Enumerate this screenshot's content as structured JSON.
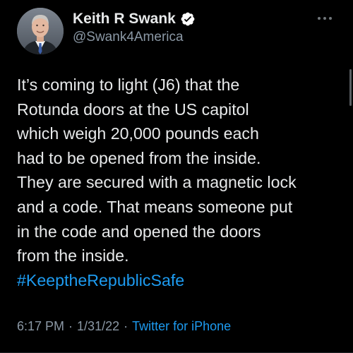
{
  "author": {
    "display_name": "Keith R Swank",
    "handle": "@Swank4America",
    "verified_icon": "verified-badge-icon",
    "verified_color": "#ffffff"
  },
  "more_icon": "more-options-icon",
  "tweet": {
    "lines": [
      "It’s coming to light (J6) that the",
      "Rotunda doors at the US capitol",
      "which weigh 20,000 pounds each",
      "had to be opened from the inside.",
      "They are secured with a magnetic lock",
      "and a code. That means someone put",
      "in the code and opened the doors",
      "from the inside."
    ],
    "hashtag": "#KeeptheRepublicSafe"
  },
  "meta": {
    "time": "6:17 PM",
    "separator": "·",
    "date": "1/31/22",
    "source": "Twitter for iPhone"
  },
  "colors": {
    "background": "#000000",
    "text": "#e7e9ea",
    "secondary_text": "#8b98a5",
    "link": "#1d9bf0"
  }
}
